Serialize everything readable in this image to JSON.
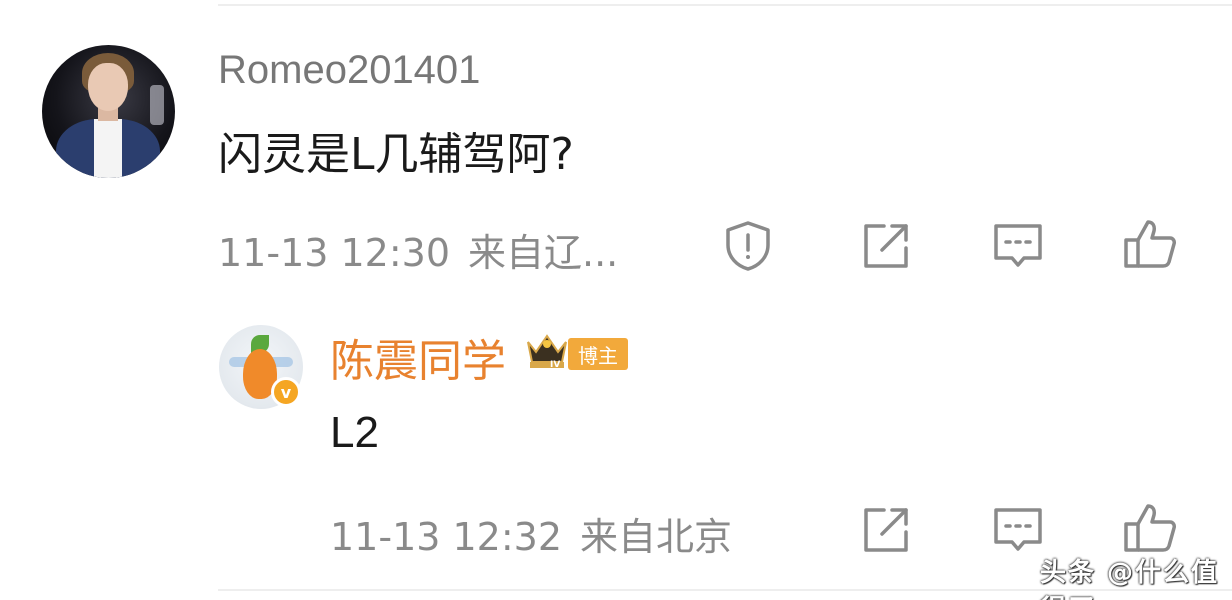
{
  "comment": {
    "username": "Romeo201401",
    "text": "闪灵是L几辅驾阿?",
    "time": "11-13 12:30",
    "location": "来自辽..."
  },
  "reply": {
    "username": "陈震同学",
    "badge": "博主",
    "level": "IV",
    "verified_mark": "v",
    "text": "L2",
    "time": "11-13 12:32",
    "location": "来自北京"
  },
  "icons": {
    "report": "shield-exclamation-icon",
    "share": "share-icon",
    "reply": "comment-icon",
    "like": "thumbs-up-icon"
  },
  "watermark": "头条 @什么值得买",
  "colors": {
    "username": "#777777",
    "blogger_name": "#e8822f",
    "badge_bg": "#f2a93b",
    "meta": "#8a8a8a",
    "icon": "#8a8a8a"
  }
}
